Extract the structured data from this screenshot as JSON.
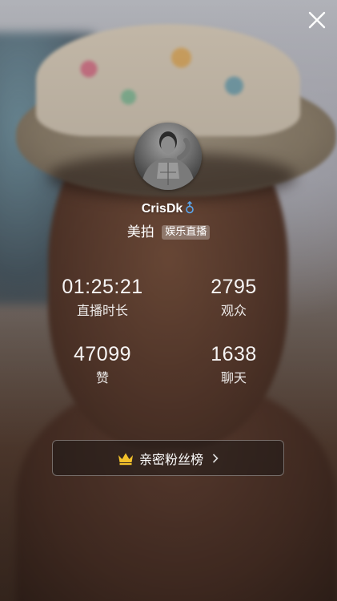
{
  "profile": {
    "username": "CrisDk",
    "gender_icon": "male-icon",
    "gender_color": "#5aa7ee",
    "platform": "美拍",
    "category": "娱乐直播"
  },
  "stats": {
    "duration": {
      "value": "01:25:21",
      "label": "直播时长"
    },
    "viewers": {
      "value": "2795",
      "label": "观众"
    },
    "likes": {
      "value": "47099",
      "label": "赞"
    },
    "chat": {
      "value": "1638",
      "label": "聊天"
    }
  },
  "fan_ranking": {
    "label": "亲密粉丝榜",
    "icon": "crown-icon",
    "icon_color": "#f3c12b"
  },
  "controls": {
    "close_icon": "close-icon"
  }
}
